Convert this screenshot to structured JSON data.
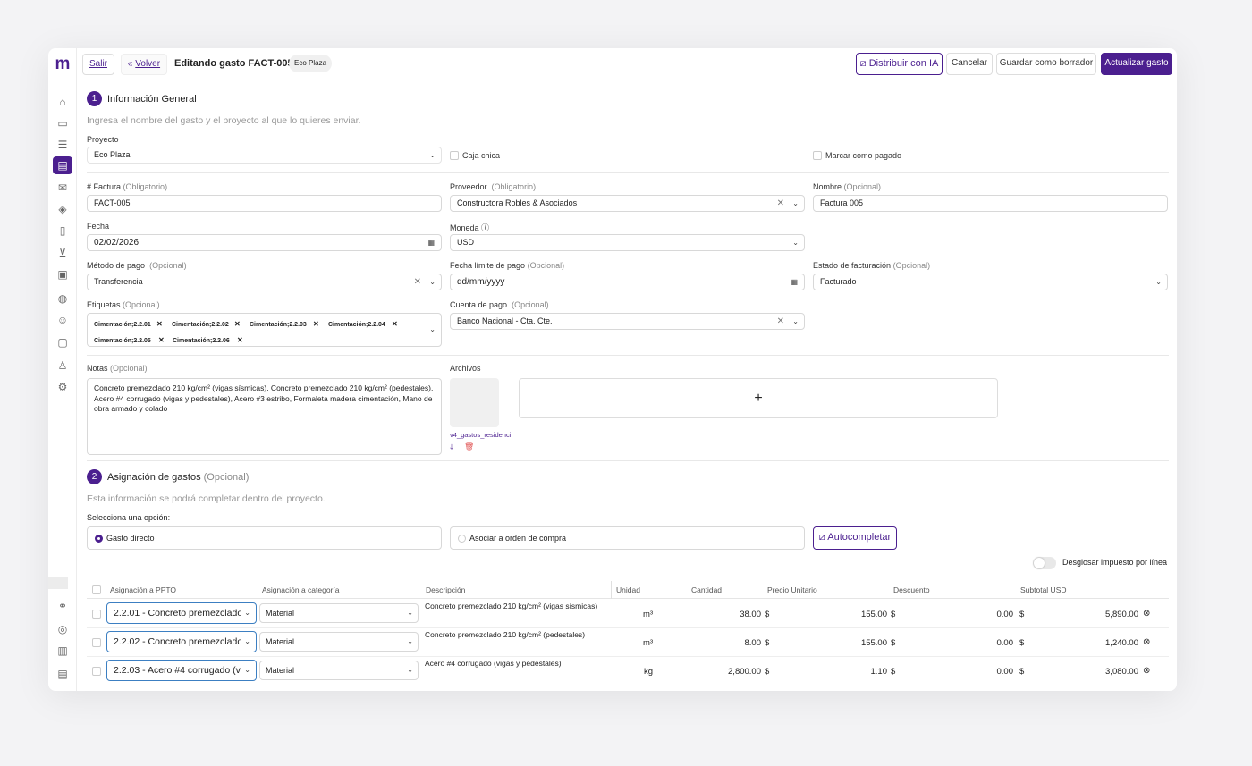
{
  "header": {
    "exit_label": "Salir",
    "back_label": "Volver",
    "title": "Editando gasto FACT-005",
    "project_chip": "Eco Plaza",
    "distribute_label": "Distribuir con IA",
    "cancel_label": "Cancelar",
    "draft_label": "Guardar como borrador",
    "update_label": "Actualizar gasto"
  },
  "section1": {
    "number": "1",
    "title": "Información General",
    "hint": "Ingresa el nombre del gasto y el proyecto al que lo quieres enviar.",
    "project_label": "Proyecto",
    "project_value": "Eco Plaza",
    "petty_cash_label": "Caja chica",
    "mark_paid_label": "Marcar como pagado",
    "invoice_label": "# Factura",
    "invoice_req": "(Obligatorio)",
    "invoice_value": "FACT-005",
    "supplier_label": "Proveedor",
    "supplier_req": "(Obligatorio)",
    "supplier_value": "Constructora Robles & Asociados",
    "name_label": "Nombre",
    "name_opt": "(Opcional)",
    "name_value": "Factura 005",
    "date_label": "Fecha",
    "date_value": "02/02/2026",
    "currency_label": "Moneda",
    "currency_value": "USD",
    "payment_method_label": "Método de pago",
    "payment_method_opt": "(Opcional)",
    "payment_method_value": "Transferencia",
    "due_date_label": "Fecha límite de pago",
    "due_date_opt": "(Opcional)",
    "due_date_value": "dd/mm/yyyy",
    "billing_status_label": "Estado de facturación",
    "billing_status_opt": "(Opcional)",
    "billing_status_value": "Facturado",
    "tags_label": "Etiquetas",
    "tags_opt": "(Opcional)",
    "tags": [
      "Cimentación;2.2.01",
      "Cimentación;2.2.02",
      "Cimentación;2.2.03",
      "Cimentación;2.2.04",
      "Cimentación;2.2.05",
      "Cimentación;2.2.06"
    ],
    "payment_account_label": "Cuenta de pago",
    "payment_account_opt": "(Opcional)",
    "payment_account_value": "Banco Nacional - Cta. Cte.",
    "notes_label": "Notas",
    "notes_opt": "(Opcional)",
    "notes_value": "Concreto premezclado 210 kg/cm² (vigas sísmicas), Concreto premezclado 210 kg/cm² (pedestales), Acero #4 corrugado (vigas y pedestales), Acero #3 estribo, Formaleta madera cimentación, Mano de obra armado y colado",
    "files_label": "Archivos",
    "file_name": "v4_gastos_residenci",
    "add_symbol": "+"
  },
  "section2": {
    "number": "2",
    "title": "Asignación de gastos",
    "title_opt": "(Opcional)",
    "hint": "Esta información se podrá completar dentro del proyecto.",
    "select_label": "Selecciona una opción:",
    "option_direct": "Gasto directo",
    "option_po": "Asociar a orden de compra",
    "autocomplete_label": "Autocompletar",
    "tax_toggle_label": "Desglosar impuesto por línea"
  },
  "table": {
    "headers": [
      "Asignación a PPTO",
      "Asignación a categoría",
      "Descripción",
      "Unidad",
      "Cantidad",
      "Precio Unitario",
      "Descuento",
      "Subtotal USD"
    ],
    "currency_symbol": "$",
    "rows": [
      {
        "ppto": "2.2.01 - Concreto premezclado",
        "category": "Material",
        "description": "Concreto premezclado 210 kg/cm² (vigas sísmicas)",
        "unit": "m³",
        "qty": "38.00",
        "price": "155.00",
        "discount": "0.00",
        "subtotal": "5,890.00"
      },
      {
        "ppto": "2.2.02 - Concreto premezclado",
        "category": "Material",
        "description": "Concreto premezclado 210 kg/cm² (pedestales)",
        "unit": "m³",
        "qty": "8.00",
        "price": "155.00",
        "discount": "0.00",
        "subtotal": "1,240.00"
      },
      {
        "ppto": "2.2.03 - Acero #4 corrugado (v",
        "category": "Material",
        "description": "Acero #4 corrugado (vigas y pedestales)",
        "unit": "kg",
        "qty": "2,800.00",
        "price": "1.10",
        "discount": "0.00",
        "subtotal": "3,080.00"
      }
    ]
  },
  "colors": {
    "primary": "#4b1f8f",
    "focus_border": "#3c7fc2"
  }
}
